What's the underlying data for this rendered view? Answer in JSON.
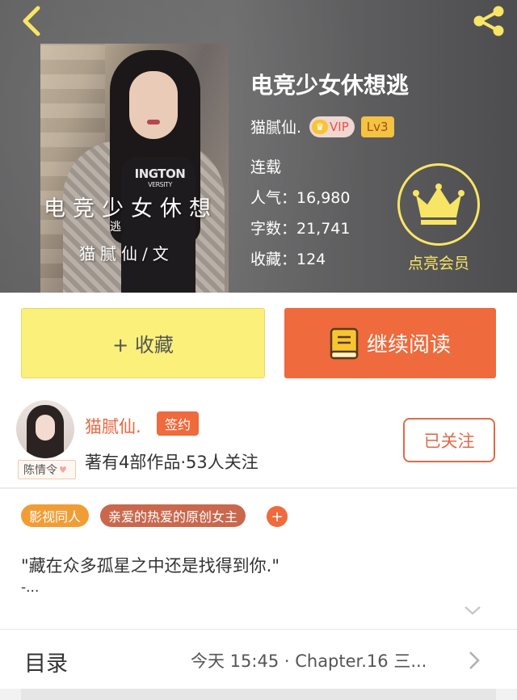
{
  "book": {
    "title": "电竞少女休想逃",
    "author": "猫腻仙.",
    "vip_label": "VIP",
    "level": "Lv3",
    "status": "连载",
    "popularity": "人气：16,980",
    "word_count": "字数：21,741",
    "favorites": "收藏：124"
  },
  "cover": {
    "shirt_text": "INGTON",
    "shirt_sub": "VERSITY",
    "title_text": "电竞少女休想",
    "extra_text": "逃",
    "author_text": "猫腻仙/文"
  },
  "membership": {
    "label": "点亮会员",
    "accent": "#f8e565"
  },
  "actions": {
    "collect_label": "+ 收藏",
    "read_label": "继续阅读"
  },
  "author_info": {
    "name": "猫腻仙.",
    "signed_badge": "签约",
    "description": "著有4部作品·53人关注",
    "avatar_tag": "陈情令",
    "follow_label": "已关注"
  },
  "tags": [
    "影视同人",
    "亲爱的热爱的原创女主"
  ],
  "tag_add": "+",
  "intro": {
    "text": "\"藏在众多孤星之中还是找得到你.\"",
    "more": "-..."
  },
  "toc": {
    "title": "目录",
    "latest": "今天 15:45 · Chapter.16 三..."
  },
  "colors": {
    "accent": "#ef6a3c",
    "collect_bg": "#faf07a",
    "header_bg": "#5f5f60"
  }
}
